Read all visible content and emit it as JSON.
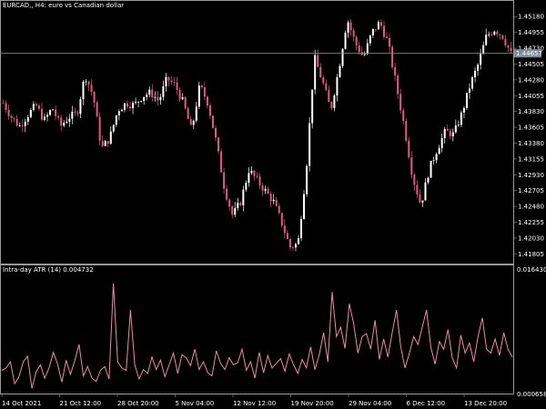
{
  "window": {
    "title": "EURCAD,, H4:  euro vs Canadian dollar",
    "current_price": "1.44657"
  },
  "colors": {
    "background": "#000000",
    "candle_bull": "#ffffff",
    "candle_bear": "#e05a86",
    "indicator_line": "#f08aa8",
    "price_line": "#8a8a8a",
    "border": "#9a9a9a",
    "tag_bg": "#7f8c99"
  },
  "price_axis": {
    "labels": [
      "1.45180",
      "1.44955",
      "1.44730",
      "1.44505",
      "1.44280",
      "1.44055",
      "1.43830",
      "1.43605",
      "1.43380",
      "1.43155",
      "1.42930",
      "1.42705",
      "1.42480",
      "1.42255",
      "1.42030",
      "1.41805"
    ]
  },
  "indicator": {
    "title": "Intra-day ATR (14) 0.004732",
    "axis_top": "0.016430",
    "axis_bottom": "0.000658"
  },
  "time_axis": {
    "labels": [
      "14 Oct 2021",
      "21 Oct 12:00",
      "28 Oct 20:00",
      "5 Nov 04:00",
      "12 Nov 12:00",
      "19 Nov 20:00",
      "29 Nov 04:00",
      "6 Dec 12:00",
      "13 Dec 20:00"
    ]
  },
  "chart_data": [
    {
      "type": "candlestick",
      "symbol": "EURCAD",
      "timeframe": "H4",
      "title": "EURCAD,, H4:  euro vs Canadian dollar",
      "ylim": [
        1.4168,
        1.4539
      ],
      "current_price": 1.44657,
      "x": [
        "14 Oct 2021",
        "21 Oct 12:00",
        "28 Oct 20:00",
        "5 Nov 04:00",
        "12 Nov 12:00",
        "19 Nov 20:00",
        "29 Nov 04:00",
        "6 Dec 12:00",
        "13 Dec 20:00"
      ],
      "close_path": [
        1.4395,
        1.4375,
        1.4362,
        1.4378,
        1.4392,
        1.437,
        1.4388,
        1.4362,
        1.4375,
        1.438,
        1.4435,
        1.4405,
        1.433,
        1.4345,
        1.4385,
        1.4395,
        1.4392,
        1.4405,
        1.441,
        1.4398,
        1.443,
        1.442,
        1.4395,
        1.4355,
        1.442,
        1.4395,
        1.434,
        1.4275,
        1.4235,
        1.4255,
        1.43,
        1.4285,
        1.427,
        1.4255,
        1.4225,
        1.419,
        1.4195,
        1.43,
        1.446,
        1.4425,
        1.4385,
        1.4445,
        1.4515,
        1.448,
        1.446,
        1.4495,
        1.451,
        1.448,
        1.442,
        1.436,
        1.429,
        1.425,
        1.43,
        1.433,
        1.4355,
        1.435,
        1.438,
        1.442,
        1.445,
        1.449,
        1.45,
        1.449,
        1.4465
      ]
    },
    {
      "type": "line",
      "title": "Intra-day ATR (14) 0.004732",
      "ylim": [
        0.000658,
        0.01643
      ],
      "series": [
        {
          "name": "Intra-day ATR (14)",
          "values": [
            0.0035,
            0.0038,
            0.0046,
            0.0018,
            0.0027,
            0.0046,
            0.0053,
            0.0012,
            0.0033,
            0.0042,
            0.0025,
            0.0038,
            0.0058,
            0.0043,
            0.002,
            0.0048,
            0.003,
            0.0047,
            0.0068,
            0.0028,
            0.004,
            0.0025,
            0.0021,
            0.0035,
            0.004,
            0.0024,
            0.0146,
            0.0046,
            0.0038,
            0.0035,
            0.0112,
            0.0042,
            0.0024,
            0.0036,
            0.0031,
            0.0052,
            0.0036,
            0.0048,
            0.0027,
            0.0042,
            0.0057,
            0.0031,
            0.0055,
            0.0051,
            0.0041,
            0.0062,
            0.0036,
            0.0046,
            0.0032,
            0.0028,
            0.006,
            0.0044,
            0.0036,
            0.0051,
            0.0042,
            0.0045,
            0.0062,
            0.0035,
            0.0046,
            0.0025,
            0.0058,
            0.0032,
            0.0054,
            0.0038,
            0.0044,
            0.005,
            0.0034,
            0.0056,
            0.0042,
            0.0031,
            0.0049,
            0.0038,
            0.0065,
            0.0036,
            0.0055,
            0.0083,
            0.0046,
            0.0135,
            0.0078,
            0.009,
            0.0063,
            0.012,
            0.0095,
            0.0057,
            0.0078,
            0.0082,
            0.0062,
            0.0099,
            0.0049,
            0.0075,
            0.0052,
            0.0083,
            0.0112,
            0.0065,
            0.0038,
            0.0057,
            0.0078,
            0.0068,
            0.009,
            0.0112,
            0.0065,
            0.0043,
            0.0072,
            0.0062,
            0.0087,
            0.0051,
            0.0038,
            0.008,
            0.0057,
            0.007,
            0.0046,
            0.0078,
            0.0102,
            0.0062,
            0.0057,
            0.0075,
            0.0054,
            0.0083,
            0.0062,
            0.0052
          ]
        }
      ]
    }
  ]
}
